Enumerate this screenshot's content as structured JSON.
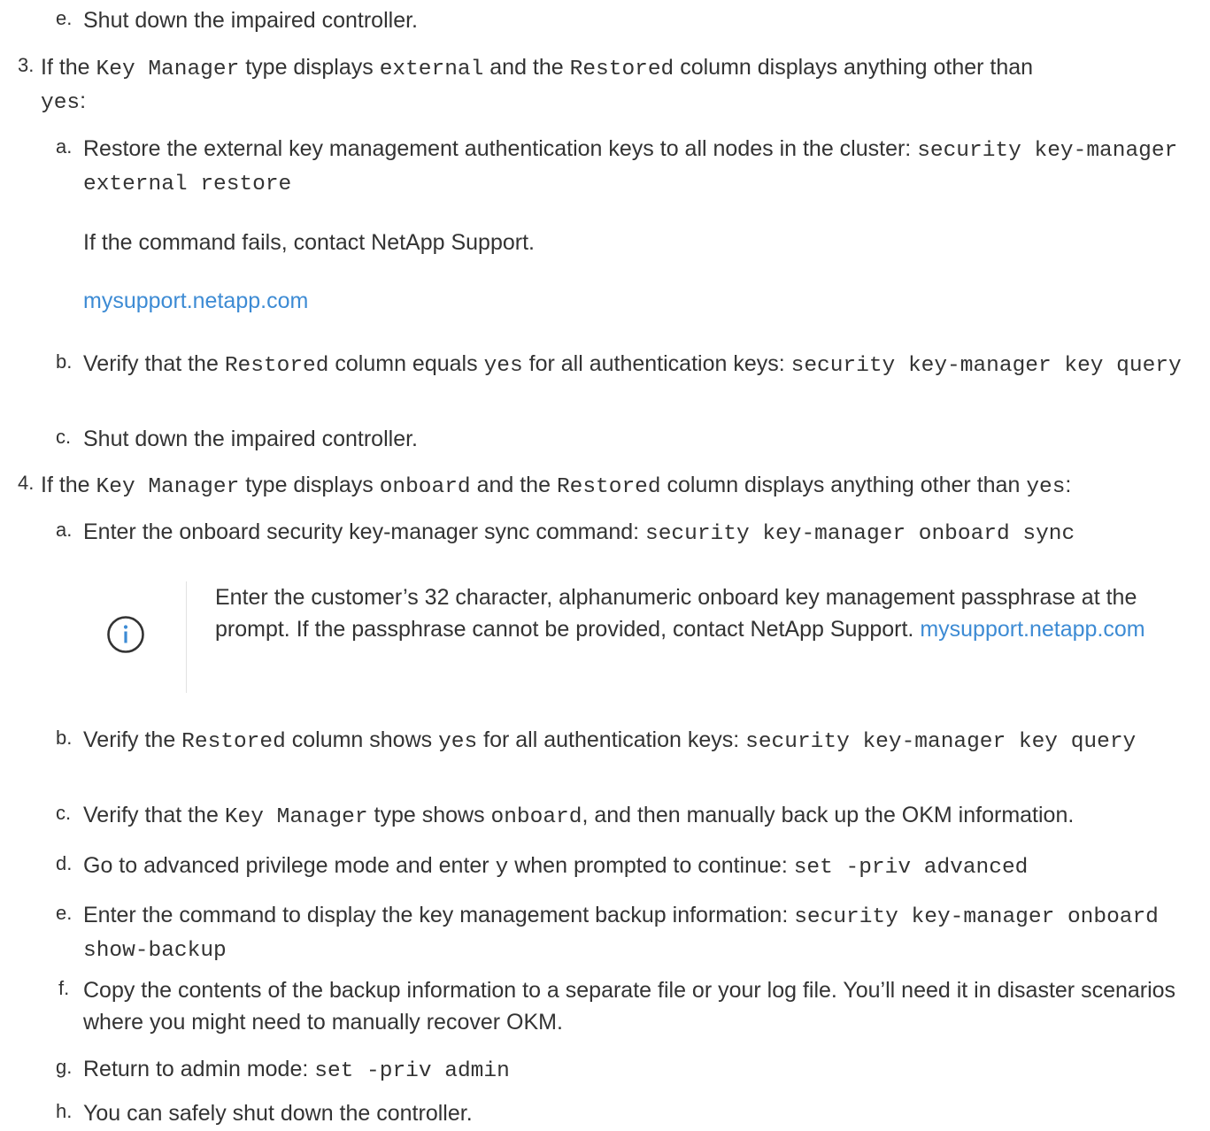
{
  "step_2e": {
    "marker": "e.",
    "text": "Shut down the impaired controller."
  },
  "step_3": {
    "marker": "3.",
    "t1": "If the ",
    "c1": "Key Manager",
    "t2": " type displays ",
    "c2": "external",
    "t3": " and the ",
    "c3": "Restored",
    "t4": " column displays anything other than ",
    "c4": "yes",
    "t5": ":",
    "a": {
      "marker": "a.",
      "text": "Restore the external key management authentication keys to all nodes in the cluster: ",
      "code": "security key-manager external restore"
    },
    "fail_text": "If the command fails, contact NetApp Support.",
    "link": "mysupport.netapp.com",
    "b": {
      "marker": "b.",
      "t1": "Verify that the ",
      "c1": "Restored",
      "t2": " column equals ",
      "c2": "yes",
      "t3": " for all authentication keys: ",
      "code": "security key-manager key query"
    },
    "c": {
      "marker": "c.",
      "text": "Shut down the impaired controller."
    }
  },
  "step_4": {
    "marker": "4.",
    "t1": "If the ",
    "c1": "Key Manager",
    "t2": " type displays ",
    "c2": "onboard",
    "t3": " and the ",
    "c3": "Restored",
    "t4": " column displays anything other than ",
    "c4": "yes",
    "t5": ":",
    "a": {
      "marker": "a.",
      "text": "Enter the onboard security key-manager sync command: ",
      "code": "security key-manager onboard sync"
    },
    "note": {
      "icon": "info-icon",
      "text": "Enter the customer’s 32 character, alphanumeric onboard key management passphrase at the prompt. If the passphrase cannot be provided, contact NetApp Support. ",
      "link": "mysupport.netapp.com"
    },
    "b": {
      "marker": "b.",
      "t1": "Verify the ",
      "c1": "Restored",
      "t2": " column shows ",
      "c2": "yes",
      "t3": " for all authentication keys: ",
      "code": "security key-manager key query"
    },
    "c": {
      "marker": "c.",
      "t1": "Verify that the ",
      "c1": "Key Manager",
      "t2": " type shows ",
      "c2": "onboard",
      "t3": ", and then manually back up the OKM information."
    },
    "d": {
      "marker": "d.",
      "t1": "Go to advanced privilege mode and enter ",
      "c1": "y",
      "t2": " when prompted to continue: ",
      "code": "set -priv advanced"
    },
    "e": {
      "marker": "e.",
      "text": "Enter the command to display the key management backup information: ",
      "code": "security key-manager onboard show-backup"
    },
    "f": {
      "marker": "f.",
      "text": "Copy the contents of the backup information to a separate file or your log file. You’ll need it in disaster scenarios where you might need to manually recover OKM."
    },
    "g": {
      "marker": "g.",
      "text": "Return to admin mode: ",
      "code": "set -priv admin"
    },
    "h": {
      "marker": "h.",
      "text": "You can safely shut down the controller."
    }
  },
  "colors": {
    "text": "#333333",
    "link": "#3d8bd4",
    "divider": "#e2e2e2"
  }
}
